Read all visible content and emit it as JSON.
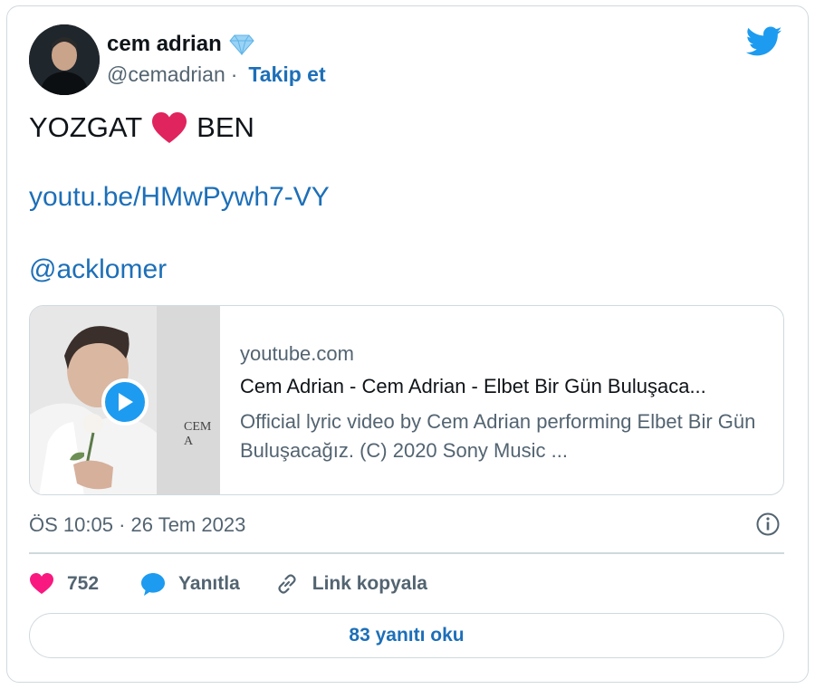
{
  "author": {
    "name": "cem adrian",
    "handle": "@cemadrian",
    "separator": "·",
    "follow_label": "Takip et"
  },
  "tweet": {
    "text_before": "YOZGAT",
    "text_after": "BEN",
    "link": "youtu.be/HMwPywh7-VY",
    "mention": "@acklomer"
  },
  "link_card": {
    "domain": "youtube.com",
    "title": "Cem Adrian - Cem Adrian - Elbet Bir Gün Buluşaca...",
    "description": "Official lyric video by Cem Adrian performing Elbet Bir Gün Buluşacağız. (C) 2020 Sony Music ...",
    "thumb_caption": "CEM A"
  },
  "meta": {
    "timestamp": "ÖS 10:05 · 26 Tem 2023"
  },
  "actions": {
    "likes_count": "752",
    "reply_label": "Yanıtla",
    "copy_link_label": "Link kopyala"
  },
  "footer": {
    "read_replies_label": "83 yanıtı oku"
  },
  "colors": {
    "link_blue": "#1d6fb8",
    "twitter_blue": "#1d9bf0",
    "like_pink": "#f91880",
    "heart_red": "#e0245e",
    "border": "#cfd9de",
    "muted_text": "#536471"
  },
  "icons": [
    "verified-diamond-icon",
    "twitter-bird-icon",
    "red-heart-emoji",
    "play-icon",
    "info-icon",
    "like-heart-icon",
    "reply-bubble-icon",
    "link-icon"
  ]
}
